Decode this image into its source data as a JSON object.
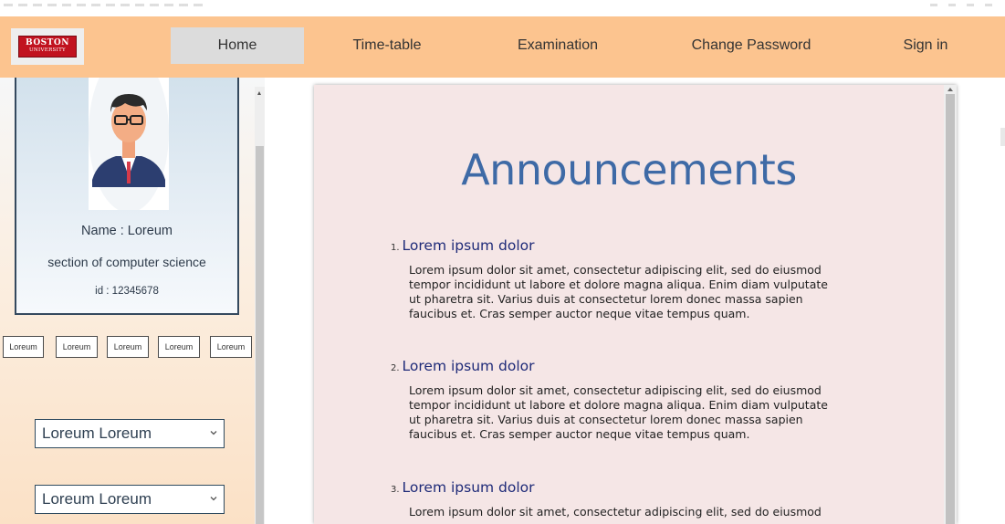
{
  "nav": {
    "logo": {
      "line1": "BOSTON",
      "line2": "UNIVERSITY"
    },
    "items": [
      {
        "label": "Home",
        "active": true
      },
      {
        "label": "Time-table",
        "active": false
      },
      {
        "label": "Examination",
        "active": false
      },
      {
        "label": "Change Password",
        "active": false
      },
      {
        "label": "Sign in",
        "active": false
      }
    ],
    "background_color": "#fcc48f"
  },
  "sidebar": {
    "profile": {
      "name_line": "Name : Loreum",
      "section_line": "section of computer science",
      "id_line": "id : 12345678",
      "avatar_icon": "person-avatar-icon"
    },
    "chips": [
      "Loreum",
      "Loreum",
      "Loreum",
      "Loreum",
      "Loreum"
    ],
    "selects": [
      {
        "value": "Loreum Loreum",
        "icon": "chevron-down-icon"
      },
      {
        "value": "Loreum Loreum",
        "icon": "chevron-down-icon"
      }
    ]
  },
  "main": {
    "title": "Announcements",
    "title_color": "#3e6aa6",
    "panel_background": "#f5e6e6",
    "announcements": [
      {
        "number": "1.",
        "heading": "Lorem ipsum dolor",
        "lines": [
          "Lorem ipsum dolor sit amet, consectetur adipiscing elit, sed do eiusmod",
          "tempor incididunt ut labore et dolore magna aliqua. Enim diam vulputate",
          "ut pharetra sit. Varius duis at consectetur lorem donec massa sapien",
          "faucibus et. Cras semper auctor neque vitae tempus quam."
        ]
      },
      {
        "number": "2.",
        "heading": "Lorem ipsum dolor",
        "lines": [
          "Lorem ipsum dolor sit amet, consectetur adipiscing elit, sed do eiusmod",
          "tempor incididunt ut labore et dolore magna aliqua. Enim diam vulputate",
          "ut pharetra sit. Varius duis at consectetur lorem donec massa sapien",
          "faucibus et. Cras semper auctor neque vitae tempus quam."
        ]
      },
      {
        "number": "3.",
        "heading": "Lorem ipsum dolor",
        "lines": [
          "Lorem ipsum dolor sit amet, consectetur adipiscing elit, sed do eiusmod"
        ]
      }
    ]
  }
}
